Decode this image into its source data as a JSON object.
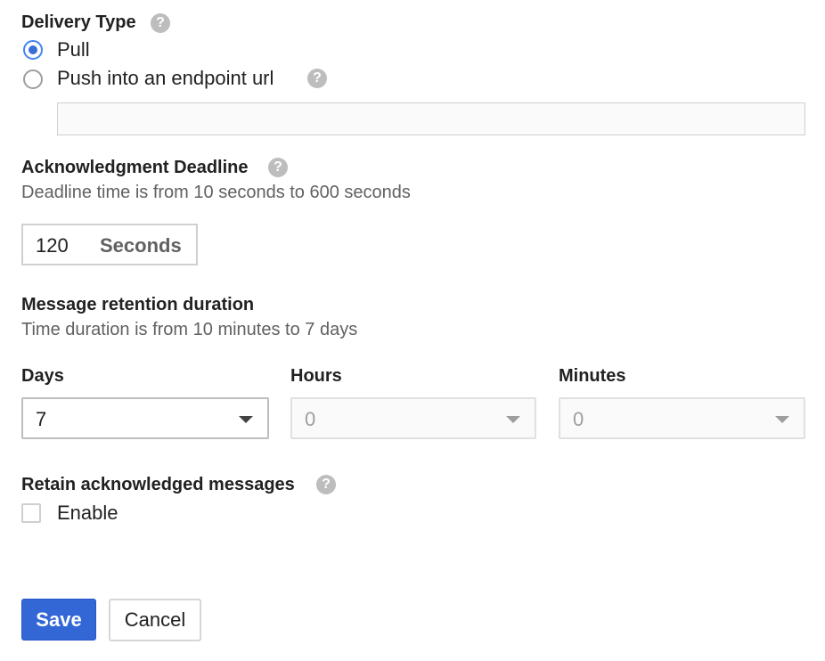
{
  "delivery": {
    "heading": "Delivery Type",
    "help_glyph": "?",
    "options": [
      {
        "label": "Pull",
        "checked": true
      },
      {
        "label": "Push into an endpoint url",
        "checked": false
      }
    ],
    "endpoint_url": {
      "value": "",
      "placeholder": ""
    }
  },
  "ack_deadline": {
    "heading": "Acknowledgment Deadline",
    "hint": "Deadline time is from 10 seconds to 600 seconds",
    "value": "120",
    "unit": "Seconds"
  },
  "retention": {
    "heading": "Message retention duration",
    "hint": "Time duration is from 10 minutes to 7 days",
    "days": {
      "label": "Days",
      "value": "7",
      "disabled": false
    },
    "hours": {
      "label": "Hours",
      "value": "0",
      "disabled": true
    },
    "minutes": {
      "label": "Minutes",
      "value": "0",
      "disabled": true
    }
  },
  "retain_acked": {
    "heading": "Retain acknowledged messages",
    "checkbox_label": "Enable",
    "checked": false
  },
  "actions": {
    "save_label": "Save",
    "cancel_label": "Cancel"
  },
  "colors": {
    "primary": "#3367d6",
    "radio_checked": "#3b6fd8",
    "help_icon": "#bdbdbd"
  },
  "icons": {
    "help": "help-circle-icon",
    "dropdown": "chevron-down-icon"
  }
}
